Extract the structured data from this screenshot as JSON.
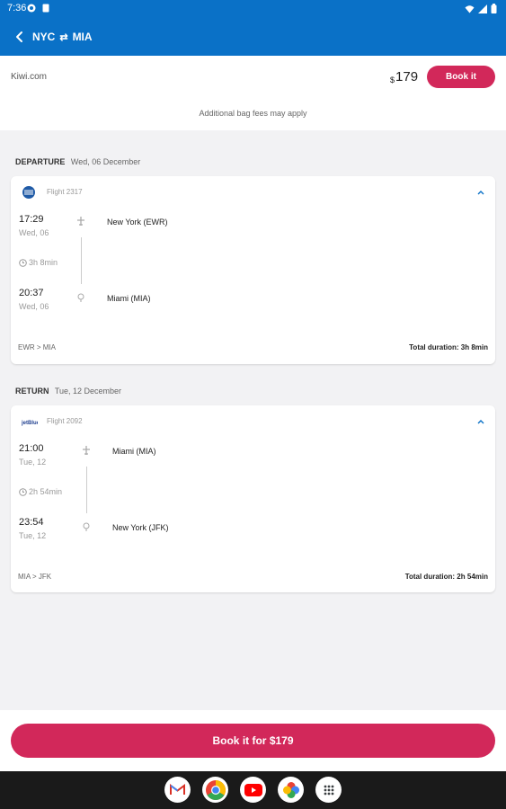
{
  "status_bar": {
    "time": "7:36"
  },
  "app_bar": {
    "origin": "NYC",
    "destination": "MIA",
    "route_arrow": "⇄"
  },
  "header": {
    "vendor": "Kiwi.com",
    "currency": "$",
    "price": "179",
    "book_label": "Book it",
    "note": "Additional bag fees may apply"
  },
  "departure": {
    "label": "DEPARTURE",
    "date": "Wed, 06 December",
    "flight": "Flight 2317",
    "dep_time": "17:29",
    "dep_date": "Wed, 06",
    "duration": "3h 8min",
    "arr_time": "20:37",
    "arr_date": "Wed, 06",
    "from_place": "New York (EWR)",
    "to_place": "Miami (MIA)",
    "route": "EWR > MIA",
    "total": "Total duration: 3h 8min"
  },
  "return": {
    "label": "RETURN",
    "date": "Tue, 12 December",
    "flight": "Flight 2092",
    "dep_time": "21:00",
    "dep_date": "Tue, 12",
    "duration": "2h 54min",
    "arr_time": "23:54",
    "arr_date": "Tue, 12",
    "from_place": "Miami (MIA)",
    "to_place": "New York (JFK)",
    "route": "MIA > JFK",
    "total": "Total duration: 2h 54min"
  },
  "bottom": {
    "book_label": "Book it for $179"
  },
  "colors": {
    "brand_blue": "#0a71c7",
    "accent_pink": "#d2285a"
  },
  "dock_apps": [
    "gmail-icon",
    "chrome-icon",
    "youtube-icon",
    "photos-icon",
    "app-drawer-icon"
  ]
}
